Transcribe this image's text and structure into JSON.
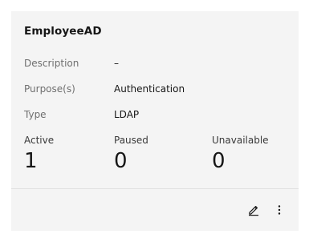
{
  "card": {
    "title": "EmployeeAD",
    "rows": [
      {
        "label": "Description",
        "value": "–"
      },
      {
        "label": "Purpose(s)",
        "value": "Authentication"
      },
      {
        "label": "Type",
        "value": "LDAP"
      }
    ],
    "stats": [
      {
        "label": "Active",
        "value": "1"
      },
      {
        "label": "Paused",
        "value": "0"
      },
      {
        "label": "Unavailable",
        "value": "0"
      }
    ],
    "actions": {
      "edit_icon": "pencil-edit-icon",
      "more_icon": "overflow-menu-vertical-icon"
    }
  }
}
